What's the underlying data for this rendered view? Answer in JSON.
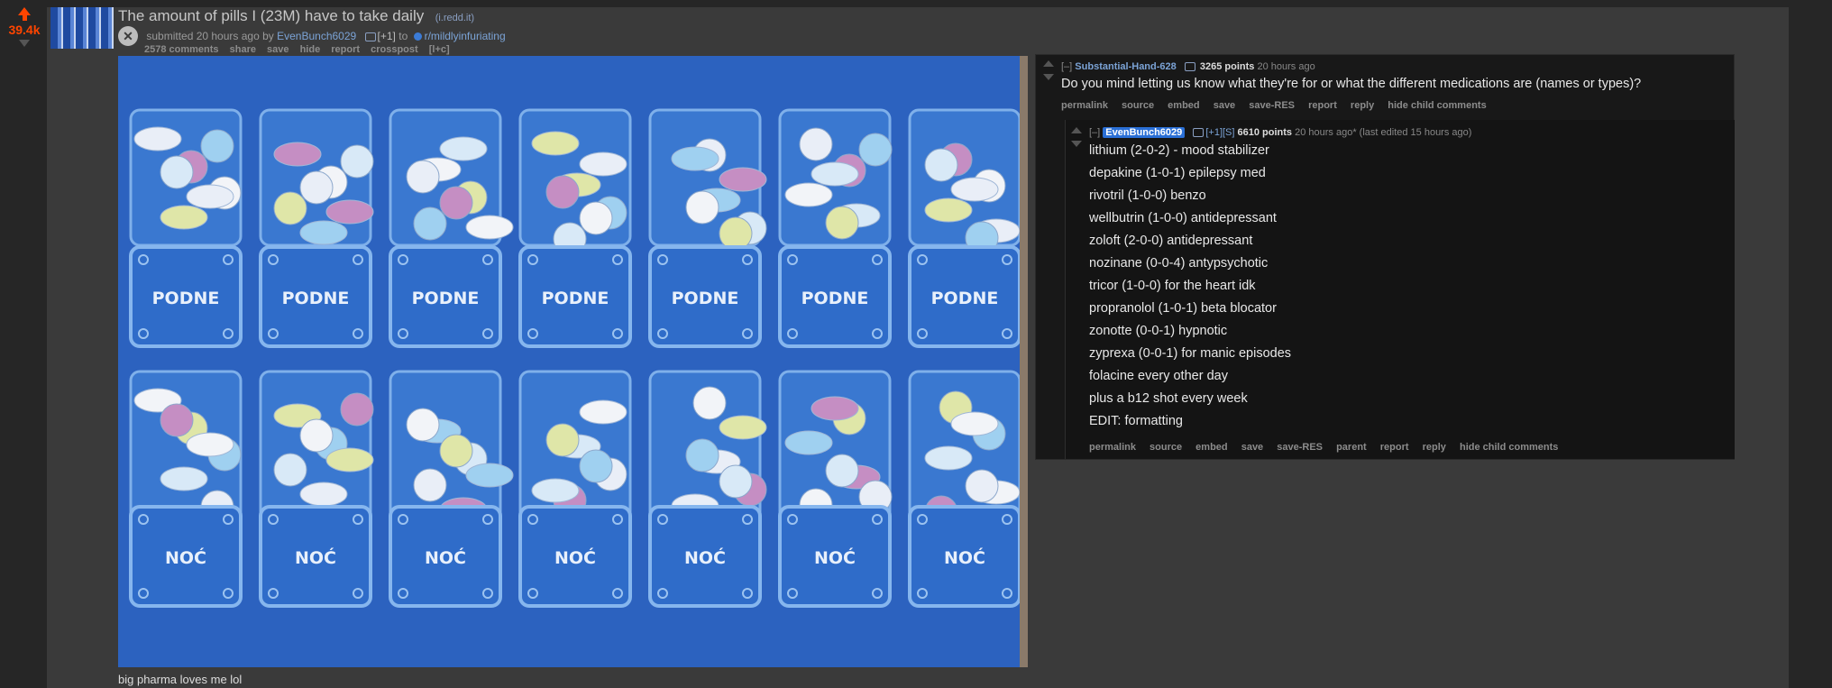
{
  "post": {
    "score": "39.4k",
    "title": "The amount of pills I (23M) have to take daily",
    "domain": "(i.redd.it)",
    "tagline": {
      "submitted": "submitted 20 hours ago by",
      "author": "EvenBunch6029",
      "plus1": "[+1]",
      "to": "to",
      "subreddit": "r/mildlyinfuriating"
    },
    "buttons": [
      "2578 comments",
      "share",
      "save",
      "hide",
      "report",
      "crosspost",
      "[l+c]"
    ],
    "expando_symbol": "✕",
    "caption": "big pharma loves me lol",
    "image_labels": {
      "podne": "PODNE",
      "noc": "NOĆ"
    }
  },
  "comments": [
    {
      "collapse": "[–]",
      "author": "Substantial-Hand-628",
      "points": "3265 points",
      "time": "20 hours ago",
      "body": "Do you mind letting us know what they're for or what the different medications are (names or types)?",
      "buttons": [
        "permalink",
        "source",
        "embed",
        "save",
        "save-RES",
        "report",
        "reply",
        "hide child comments"
      ]
    },
    {
      "collapse": "[–]",
      "author": "EvenBunch6029",
      "flair": "[+1][S]",
      "points": "6610 points",
      "time": "20 hours ago*",
      "edited": "(last edited 15 hours ago)",
      "lines": [
        "lithium (2-0-2) - mood stabilizer",
        "depakine (1-0-1) epilepsy med",
        "rivotril (1-0-0) benzo",
        "wellbutrin (1-0-0) antidepressant",
        "zoloft (2-0-0) antidepressant",
        "nozinane (0-0-4) antypsychotic",
        "tricor (1-0-0) for the heart idk",
        "propranolol (1-0-1) beta blocator",
        "zonotte (0-0-1) hypnotic",
        "zyprexa (0-0-1) for manic episodes",
        "folacine every other day",
        "plus a b12 shot every week",
        "EDIT: formatting"
      ],
      "buttons": [
        "permalink",
        "source",
        "embed",
        "save",
        "save-RES",
        "parent",
        "report",
        "reply",
        "hide child comments"
      ]
    }
  ],
  "colors": {
    "upvote": "#ff4500",
    "link": "#7ba3d6",
    "op_badge": "#2a6fd6"
  }
}
